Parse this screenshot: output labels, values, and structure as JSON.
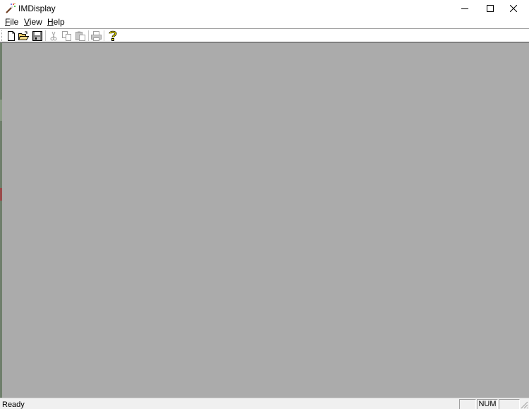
{
  "window": {
    "title": "IMDisplay",
    "app_icon": "magic-wand-icon",
    "controls": {
      "minimize_icon": "minimize-icon",
      "maximize_icon": "maximize-icon",
      "close_icon": "close-icon"
    }
  },
  "menu": {
    "file": {
      "mnemonic": "F",
      "rest": "ile"
    },
    "view": {
      "mnemonic": "V",
      "rest": "iew"
    },
    "help": {
      "mnemonic": "H",
      "rest": "elp"
    }
  },
  "toolbar": {
    "buttons": [
      {
        "icon": "new-document-icon",
        "enabled": true
      },
      {
        "icon": "open-folder-icon",
        "enabled": true
      },
      {
        "icon": "save-icon",
        "enabled": true
      },
      {
        "icon": "cut-icon",
        "enabled": false
      },
      {
        "icon": "copy-icon",
        "enabled": false
      },
      {
        "icon": "paste-icon",
        "enabled": false
      },
      {
        "icon": "print-icon",
        "enabled": false
      },
      {
        "icon": "help-icon",
        "enabled": true
      }
    ]
  },
  "client_area": {
    "background": "#ababab"
  },
  "statusbar": {
    "text": "Ready",
    "indicators": {
      "caps": "",
      "num": "NUM",
      "scrl": ""
    }
  }
}
